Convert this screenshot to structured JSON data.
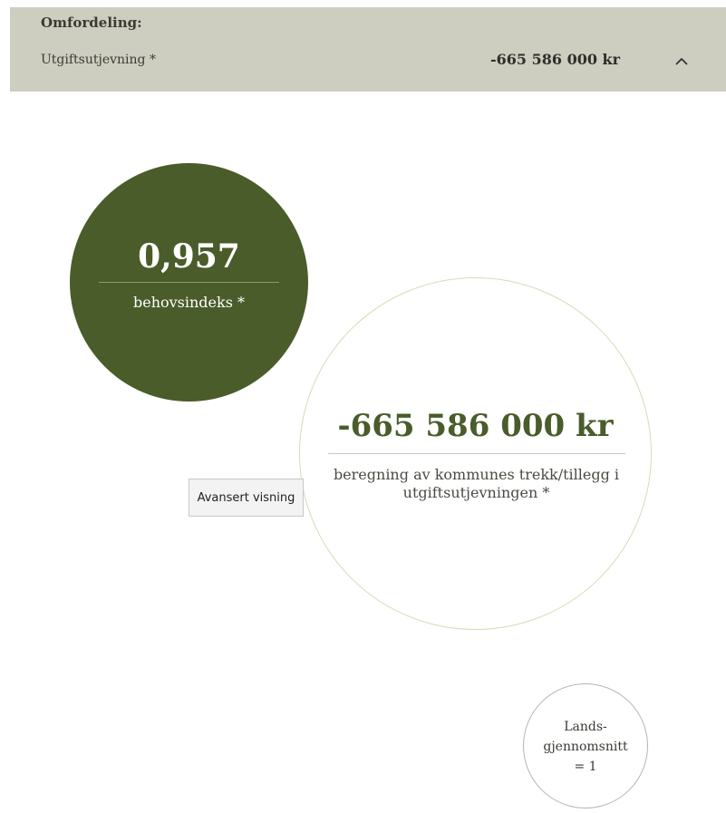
{
  "header": {
    "title": "Omfordeling:",
    "subtitle": "Utgiftsutjevning *",
    "amount": "-665 586 000 kr",
    "toggle_icon": "chevron-up-icon"
  },
  "index_circle": {
    "value": "0,957",
    "label": "behovsindeks *",
    "color": "#4a5c2a"
  },
  "result_circle": {
    "value": "-665 586 000 kr",
    "label": "beregning av kommunes trekk/tillegg i utgiftsutjevningen *",
    "value_color": "#4a5c2a"
  },
  "advanced_button": {
    "label": "Avansert visning"
  },
  "national_average": {
    "line1": "Lands-",
    "line2": "gjennomsnitt",
    "line3": "= 1"
  },
  "colors": {
    "header_bg": "#cdcec0",
    "accent": "#4a5c2a"
  }
}
